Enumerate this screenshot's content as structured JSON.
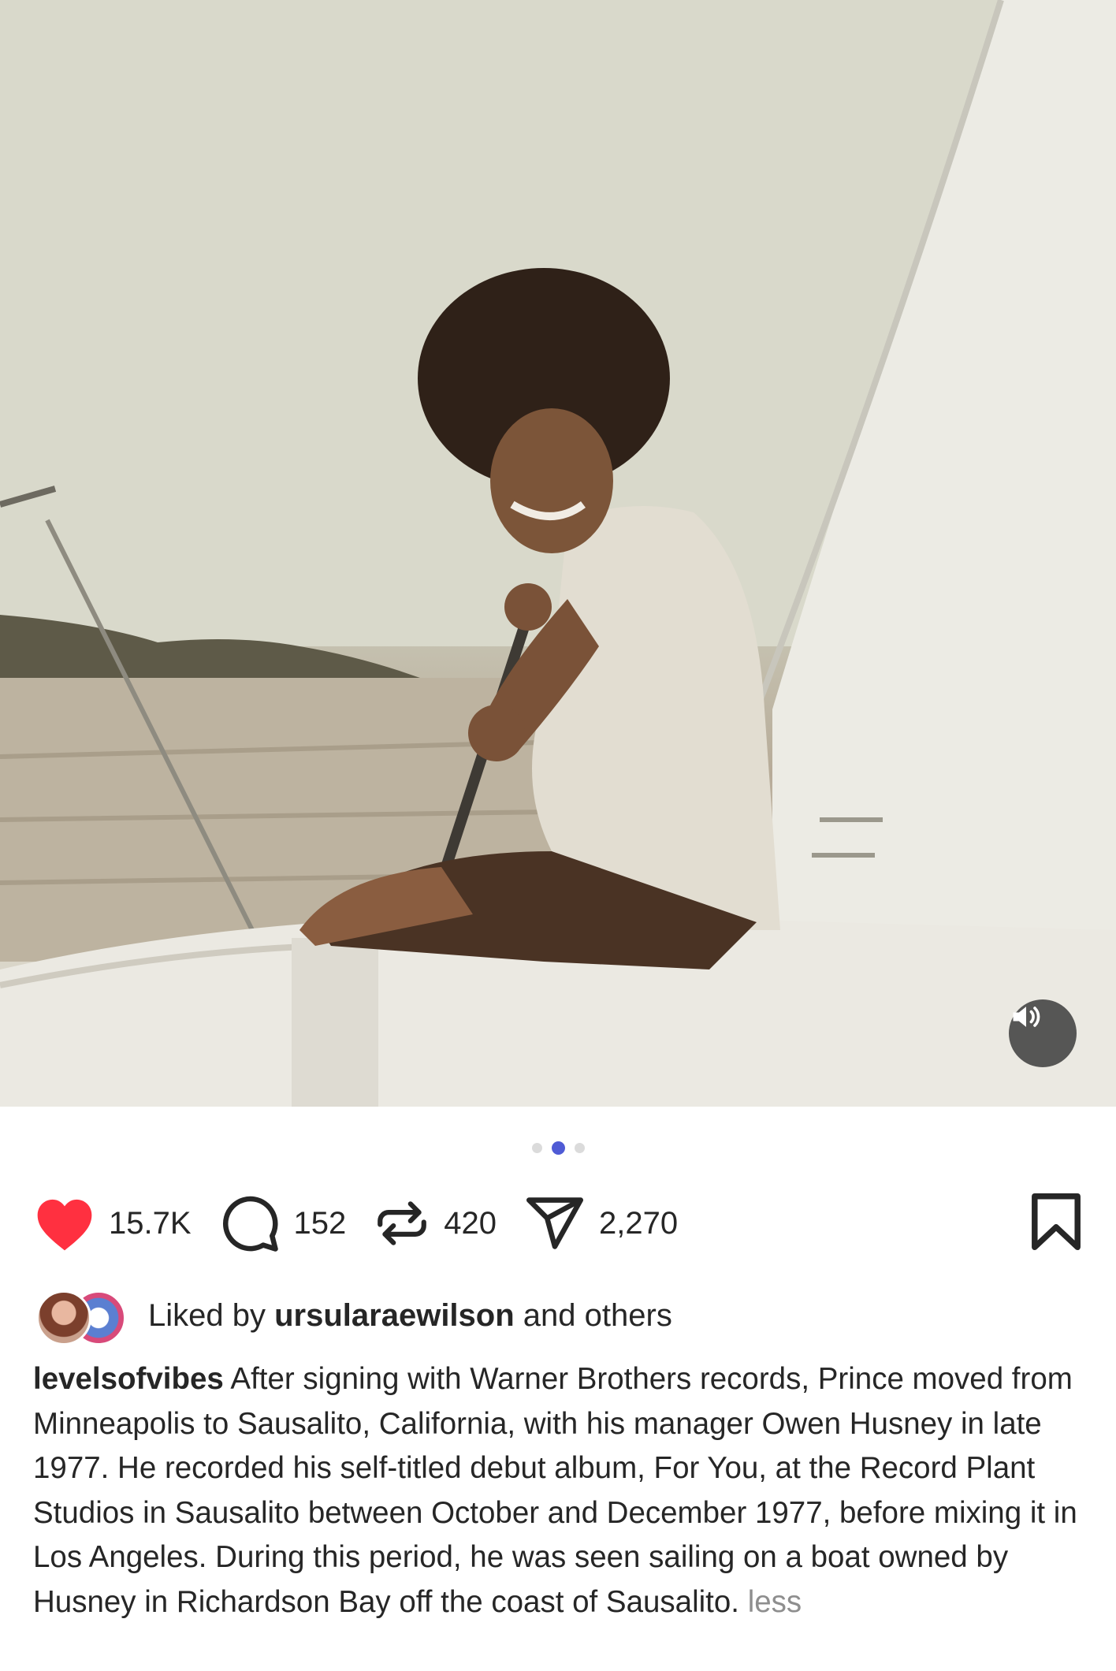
{
  "post": {
    "media": {
      "carousel_total": 3,
      "carousel_active_index": 1,
      "mute_icon": "speaker-icon"
    },
    "actions": {
      "like_icon": "heart-icon",
      "like_count": "15.7K",
      "comment_icon": "comment-bubble-icon",
      "comment_count": "152",
      "repost_icon": "repost-icon",
      "repost_count": "420",
      "share_icon": "paper-plane-icon",
      "share_count": "2,270",
      "bookmark_icon": "bookmark-icon",
      "like_color": "#ff3040"
    },
    "liked_by": {
      "prefix": "Liked by",
      "user": "ursularaewilson",
      "suffix": "and others"
    },
    "caption": {
      "username": "levelsofvibes",
      "text": "After signing with Warner Brothers records, Prince moved from Minneapolis to Sausalito, California, with his manager Owen Husney in late 1977. He recorded his self-titled debut album, For You, at the Record Plant Studios in Sausalito between October and December 1977, before mixing it in Los Angeles. During this period, he was seen sailing on a boat owned by Husney in Richardson Bay off the coast of Sausalito.",
      "less_label": "less"
    }
  }
}
